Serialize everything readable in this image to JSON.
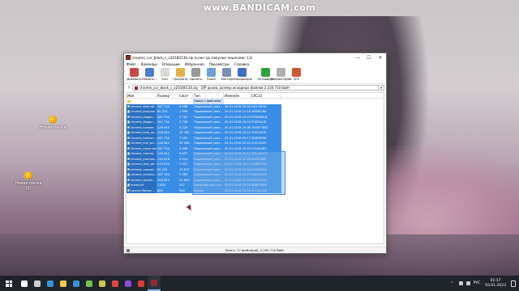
{
  "watermark": "www.BANDICAM.com",
  "desktop": {
    "icons": [
      {
        "label": "Новая папка",
        "icon": "folder-icon"
      },
      {
        "label": "Новая папка (2)",
        "icon": "folder-icon"
      }
    ]
  },
  "window": {
    "title": "chrome_cur_black_c_v20180130.zip (ключ до покупки лицензии: 13)",
    "controls": {
      "minimize": "—",
      "maximize": "☐",
      "close": "✕"
    },
    "menu": [
      "Файл",
      "Команды",
      "Операции",
      "Избранное",
      "Параметры",
      "Справка"
    ],
    "toolbar": [
      {
        "label": "Добавить",
        "icon": "add-archive-icon",
        "color": "#c9484a"
      },
      {
        "label": "Извлечь...",
        "icon": "extract-icon",
        "color": "#4a7fc9"
      },
      {
        "label": "Тест",
        "icon": "test-icon",
        "color": "#d8d8d8"
      },
      {
        "label": "Просмотр",
        "icon": "view-icon",
        "color": "#e4b24a"
      },
      {
        "label": "Удалить",
        "icon": "delete-icon",
        "color": "#9a9a9a"
      },
      {
        "label": "Поиск",
        "icon": "search-icon",
        "color": "#6aa0d8"
      },
      {
        "label": "Мастер",
        "icon": "wizard-icon",
        "color": "#7c8fb0"
      },
      {
        "label": "Информация",
        "icon": "info-icon",
        "color": "#3f6fbf"
      },
      {
        "label": "Антивирус",
        "icon": "antivirus-icon",
        "color": "#2da33a"
      },
      {
        "label": "Комментарий",
        "icon": "comment-icon",
        "color": "#b0b0b0"
      },
      {
        "label": "SFX",
        "icon": "sfx-icon",
        "color": "#d0582f"
      }
    ],
    "address": "chrome_cur_black_c_v20180130.zip - ZIP архив, размер исходных файлов 2 230 710 байт",
    "columns": {
      "name": "Имя",
      "size": "Размер",
      "packed": "Сжат",
      "type": "Тип",
      "modified": "Изменён",
      "crc": "CRC32"
    },
    "parent_row": {
      "name": "..",
      "type": "Папка с файлами"
    },
    "rows": [
      {
        "name": "chrome_alternat...",
        "size": "167 734",
        "packed": "4 588",
        "type": "Подвижный указ...",
        "modified": "26.01.2018 23:40",
        "crc": "DC574F9C"
      },
      {
        "name": "chrome_busy.ani",
        "size": "60 324",
        "packed": "1 996",
        "type": "Подвижный указ...",
        "modified": "25.01.2018 21:18",
        "crc": "3689826A"
      },
      {
        "name": "chrome_diagon...",
        "size": "167 734",
        "packed": "5 782",
        "type": "Подвижный указ...",
        "modified": "25.01.2018 23:23",
        "crc": "FEDDE8CB"
      },
      {
        "name": "chrome_diagon...",
        "size": "167 734",
        "packed": "5 798",
        "type": "Подвижный указ...",
        "modified": "25.01.2018 23:23",
        "crc": "20EE4A7E"
      },
      {
        "name": "chrome_handwr...",
        "size": "128 442",
        "packed": "3 228",
        "type": "Подвижный указ...",
        "modified": "25.01.2018 23:38",
        "crc": "1944F7B52"
      },
      {
        "name": "chrome_help_se...",
        "size": "128 442",
        "packed": "10 782",
        "type": "Подвижный указ...",
        "modified": "25.01.2018 23:12",
        "crc": "7F6714CB"
      },
      {
        "name": "chrome_horizon...",
        "size": "167 734",
        "packed": "7 292",
        "type": "Подвижный указ...",
        "modified": "25.01.2018 23:17",
        "crc": "3EDF8938"
      },
      {
        "name": "chrome_link_sel...",
        "size": "128 442",
        "packed": "25 946",
        "type": "Подвижный указ...",
        "modified": "25.01.2018 22:21",
        "crc": "07E1704C"
      },
      {
        "name": "chrome_move.ani",
        "size": "167 734",
        "packed": "3 498",
        "type": "Подвижный указ...",
        "modified": "25.01.2018 23:29",
        "crc": "57E0A4E5"
      },
      {
        "name": "chrome_normal...",
        "size": "128 442",
        "packed": "8 837",
        "type": "Подвижный указ...",
        "modified": "24.01.2018 21:13",
        "crc": "1DC4A0C9"
      },
      {
        "name": "chrome_precisio...",
        "size": "130 618",
        "packed": "4 914",
        "type": "Подвижный указ...",
        "modified": "25.01.2018 22:56",
        "crc": "3EEB4B6E"
      },
      {
        "name": "chrome_text_sel...",
        "size": "210 035",
        "packed": "7 417",
        "type": "Подвижный указ...",
        "modified": "04.01.2018 18:14",
        "crc": "43BF2458"
      },
      {
        "name": "chrome_unavail...",
        "size": "54 224",
        "packed": "13 672",
        "type": "Подвижный указ...",
        "modified": "25.01.2018 22:30",
        "crc": "096008AA"
      },
      {
        "name": "chrome_vertical...",
        "size": "167 780",
        "packed": "5 283",
        "type": "Подвижный указ...",
        "modified": "25.01.2018 23:19",
        "crc": "D6498109"
      },
      {
        "name": "chrome_workin...",
        "size": "128 852",
        "packed": "21 803",
        "type": "Подвижный указ...",
        "modified": "25.01.2018 21:23",
        "crc": "5A5362D1"
      },
      {
        "name": "Install.inf",
        "size": "1 652",
        "packed": "537",
        "type": "Сведения для уст...",
        "modified": "29.01.2018 23:54",
        "crc": "B8893AEB"
      },
      {
        "name": "Launch Mouse ...",
        "size": "865",
        "packed": "355",
        "type": "Ярлык",
        "modified": "29.01.2018 23:50",
        "crc": "2F2DC228"
      }
    ],
    "status": "Всего: 17 файла(ов), 2 230 710 байт"
  },
  "taskbar": {
    "apps": [
      {
        "icon": "search-icon",
        "color": "#ffffff"
      },
      {
        "icon": "task-view-icon",
        "color": "#cfcfcf"
      },
      {
        "icon": "edge-icon",
        "color": "#2f9ad8"
      },
      {
        "icon": "explorer-icon",
        "color": "#f2c94c"
      },
      {
        "icon": "store-icon",
        "color": "#3d8fd8"
      },
      {
        "icon": "game-icon",
        "color": "#73c04a"
      },
      {
        "icon": "app-icon",
        "color": "#c9c94a"
      },
      {
        "icon": "chrome-icon",
        "color": "#e0473b"
      },
      {
        "icon": "app2-icon",
        "color": "#8f4ad8"
      },
      {
        "icon": "record-icon",
        "color": "#d83b3b"
      },
      {
        "icon": "archive-icon",
        "color": "#8d2b2b"
      }
    ],
    "tray": {
      "lang": "РУС",
      "time": "01:17",
      "date": "03.01.2023"
    }
  }
}
